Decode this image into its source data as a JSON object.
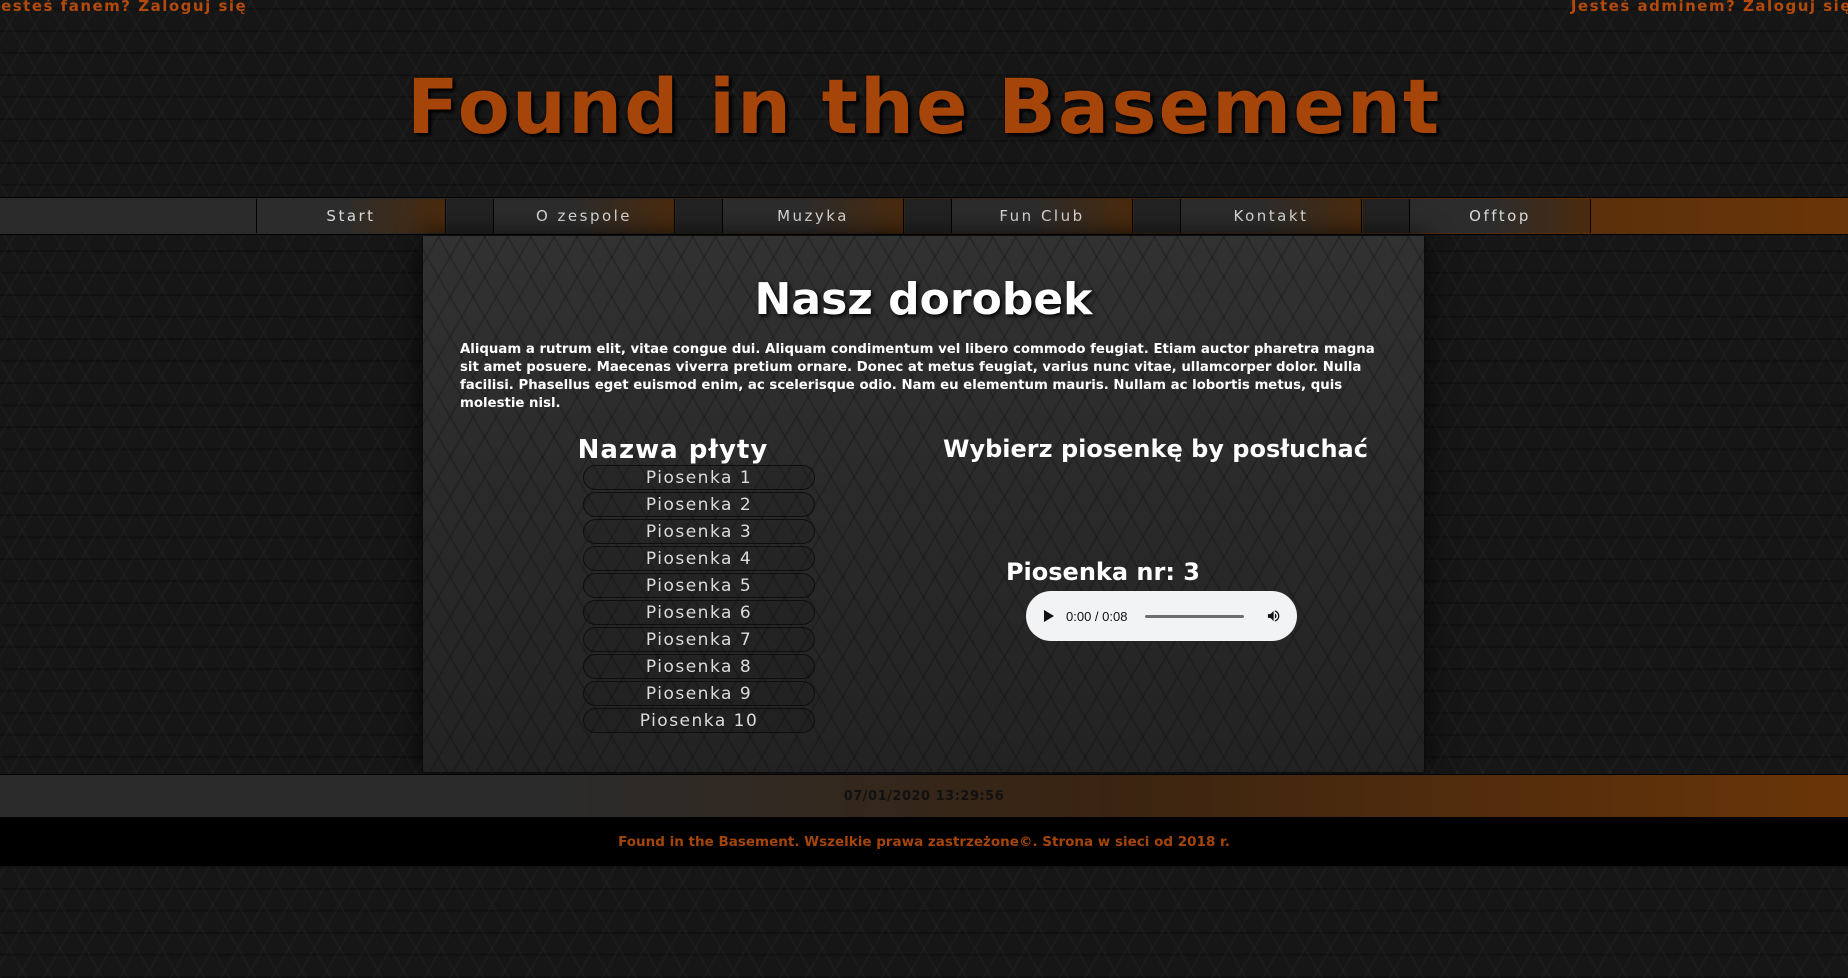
{
  "header": {
    "fan_login": "Jesteś fanem? Zaloguj się",
    "admin_login": "Jesteś adminem? Zaloguj się",
    "site_title": "Found in the Basement"
  },
  "nav": {
    "items": [
      {
        "label": "Start"
      },
      {
        "label": "O zespole"
      },
      {
        "label": "Muzyka"
      },
      {
        "label": "Fun Club"
      },
      {
        "label": "Kontakt"
      },
      {
        "label": "Offtop"
      }
    ]
  },
  "main": {
    "heading": "Nasz dorobek",
    "intro": "Aliquam a rutrum elit, vitae congue dui. Aliquam condimentum vel libero commodo feugiat. Etiam auctor pharetra magna sit amet posuere. Maecenas viverra pretium ornare. Donec at metus feugiat, varius nunc vitae, ullamcorper dolor. Nulla facilisi. Phasellus eget euismod enim, ac scelerisque odio. Nam eu elementum mauris. Nullam ac lobortis metus, quis molestie nisl.",
    "album_title": "Nazwa płyty",
    "songs": [
      "Piosenka 1",
      "Piosenka 2",
      "Piosenka 3",
      "Piosenka 4",
      "Piosenka 5",
      "Piosenka 6",
      "Piosenka 7",
      "Piosenka 8",
      "Piosenka 9",
      "Piosenka 10"
    ],
    "choose_heading": "Wybierz piosenkę by posłuchać",
    "now_playing": "Piosenka nr: 3",
    "player": {
      "time": "0:00 / 0:08",
      "play_icon": "play-icon",
      "volume_icon": "volume-icon",
      "progress": 0
    }
  },
  "footer": {
    "timestamp": "07/01/2020 13:29:56",
    "copyright": "Found in the Basement. Wszelkie prawa zastrzeżone©. Strona w sieci od 2018 r."
  },
  "colors": {
    "accent": "#a64509",
    "nav_gradient_end": "#6a3508",
    "panel_bg": "#2b2b2b",
    "copyright_bg": "#000000"
  }
}
